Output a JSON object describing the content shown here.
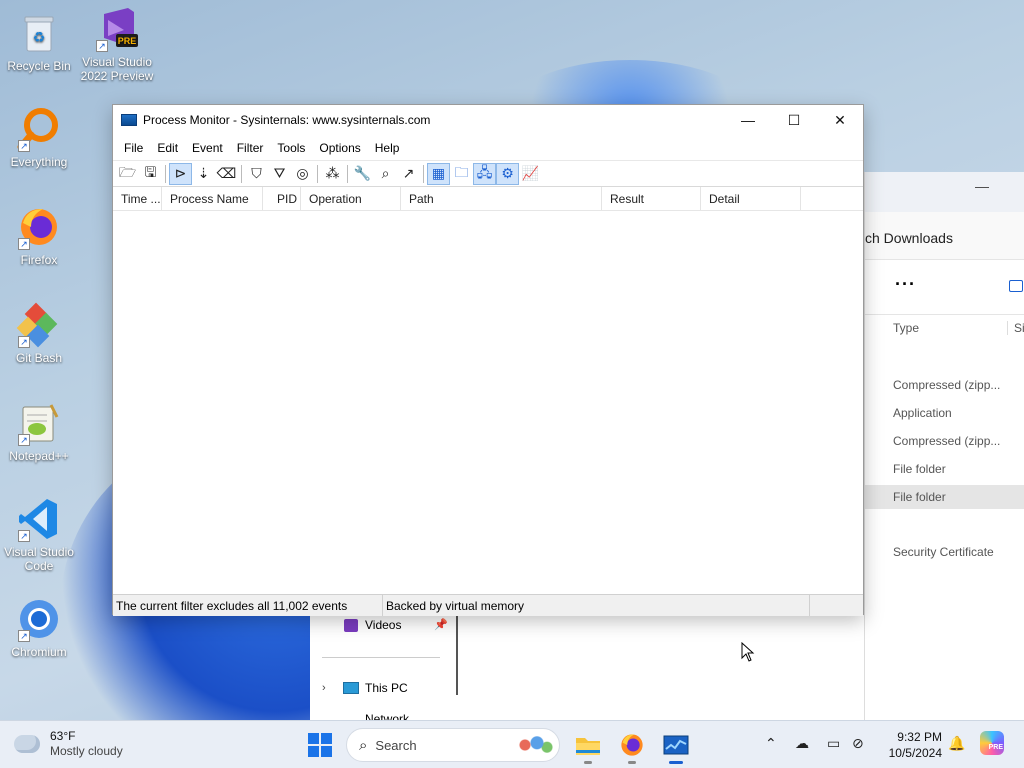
{
  "desktop": {
    "icons": [
      {
        "label": "Recycle Bin",
        "icon": "recycle-bin-icon",
        "shortcut": false
      },
      {
        "label": "Visual Studio 2022 Preview",
        "icon": "visual-studio-icon",
        "shortcut": true,
        "badge": "PRE"
      },
      {
        "label": "Everything",
        "icon": "everything-search-icon",
        "shortcut": true
      },
      {
        "label": "Firefox",
        "icon": "firefox-icon",
        "shortcut": true
      },
      {
        "label": "Git Bash",
        "icon": "git-bash-icon",
        "shortcut": true
      },
      {
        "label": "Notepad++",
        "icon": "notepad-plus-plus-icon",
        "shortcut": true
      },
      {
        "label": "Visual Studio Code",
        "icon": "vscode-icon",
        "shortcut": true
      },
      {
        "label": "Chromium",
        "icon": "chromium-icon",
        "shortcut": true
      }
    ]
  },
  "procmon": {
    "title": "Process Monitor - Sysinternals: www.sysinternals.com",
    "menu": [
      "File",
      "Edit",
      "Event",
      "Filter",
      "Tools",
      "Options",
      "Help"
    ],
    "columns": [
      "Time ...",
      "Process Name",
      "PID",
      "Operation",
      "Path",
      "Result",
      "Detail"
    ],
    "status_events": "The current filter excludes all 11,002 events",
    "status_memory": "Backed by virtual memory"
  },
  "explorer": {
    "address": "ch Downloads",
    "more": "···",
    "col_type": "Type",
    "col_size": "Siz",
    "rows": [
      "Compressed (zipp...",
      "Application",
      "Compressed (zipp...",
      "File folder",
      "File folder",
      "Security Certificate"
    ],
    "nav": {
      "videos": "Videos",
      "this_pc": "This PC",
      "network": "Network"
    }
  },
  "taskbar": {
    "temperature": "63°F",
    "condition": "Mostly cloudy",
    "search_placeholder": "Search",
    "time": "9:32 PM",
    "date": "10/5/2024"
  },
  "colors": {
    "accent": "#1a5fd0",
    "taskbar_bg": "#e9eef6",
    "selection": "#e5e5e5"
  }
}
